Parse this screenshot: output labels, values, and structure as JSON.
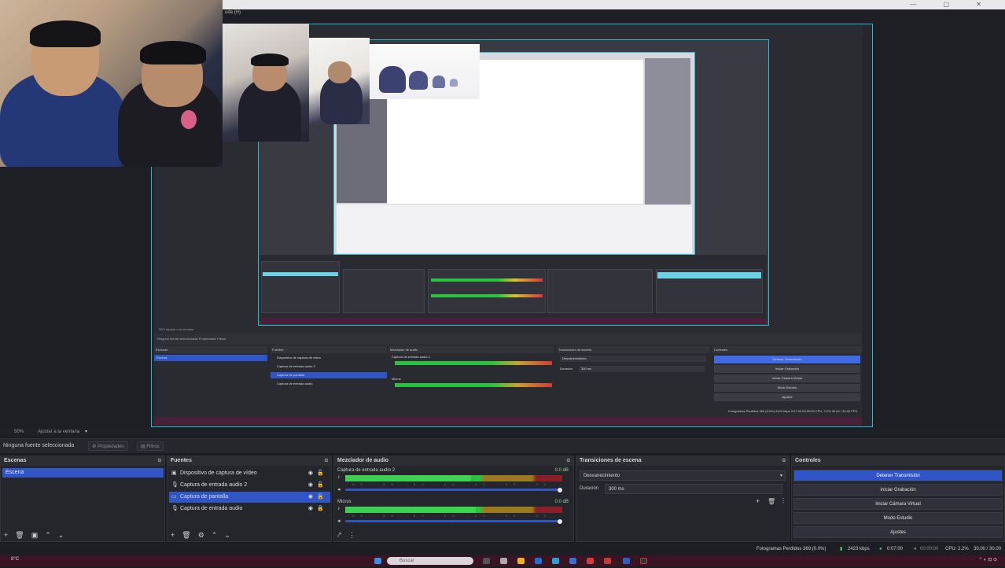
{
  "window": {
    "title": "uda (H)",
    "controls": "— ▢ ✕"
  },
  "toolbar": {
    "zoom": "50%",
    "fit": "Ajustar a la ventana"
  },
  "properties_bar": {
    "no_source": "Ninguna fuente seleccionada",
    "properties_btn": "Propiedades",
    "filters_btn": "Filtros"
  },
  "docks": {
    "scenes": {
      "title": "Escenas",
      "items": [
        "Escena"
      ]
    },
    "sources": {
      "title": "Fuentes",
      "items": [
        {
          "label": "Dispositivo de captura de vídeo",
          "icon": "camera-icon",
          "selected": false
        },
        {
          "label": "Captura de entrada audio 2",
          "icon": "microphone-icon",
          "selected": false
        },
        {
          "label": "Captura de pantalla",
          "icon": "monitor-icon",
          "selected": true
        },
        {
          "label": "Captura de entrada audio",
          "icon": "microphone-icon",
          "selected": false
        }
      ]
    },
    "mixer": {
      "title": "Mezclador de audio",
      "channels": [
        {
          "name": "Captura de entrada audio 2",
          "db": "0.0 dB",
          "level": 0.58,
          "volume": 1.0
        },
        {
          "name": "Micrus",
          "db": "0.0 dB",
          "level": 0.6,
          "volume": 1.0
        }
      ],
      "scale": "-60 -55 -50 -45 -40 -35 -30 -25 -20 -15 -10 -5 0"
    },
    "transitions": {
      "title": "Transiciones de escena",
      "selected": "Desvanecimiento",
      "duration_label": "Duración",
      "duration_value": "300 ms"
    },
    "controls": {
      "title": "Controles",
      "buttons": [
        {
          "label": "Detener Transmisión",
          "primary": true
        },
        {
          "label": "Iniciar Grabación",
          "primary": false
        },
        {
          "label": "Iniciar Cámara Virtual",
          "primary": false
        },
        {
          "label": "Modo Estudio",
          "primary": false
        },
        {
          "label": "Ajustes",
          "primary": false
        }
      ]
    }
  },
  "status": {
    "dropped_frames": "Fotogramas Perdidos 369 (0.0%)",
    "bitrate": "2423 kbps",
    "live_time": "0:07:00",
    "rec_time": "00:00:00",
    "cpu": "CPU: 2.2%",
    "fps": "30.00 / 30.00 FPS"
  },
  "taskbar": {
    "weather": "8°C",
    "search": "Buscar"
  },
  "colors": {
    "accent": "#2f55c6",
    "preview_outline": "#2fb6cf",
    "meter_green": "#2bc241",
    "meter_yellow": "#9b7a1f",
    "meter_red": "#8b1f28"
  },
  "mini": {
    "toolbar": "50%    Ajustar a la ventana",
    "props": "Ninguna fuente seleccionada        Propiedades     Filtros",
    "scenes_h": "Escenas",
    "scene": "Escena",
    "sources_h": "Fuentes",
    "src1": "Dispositivo de captura de vídeo",
    "src2": "Captura de entrada audio 2",
    "src3": "Captura de pantalla",
    "src4": "Captura de entrada audio",
    "mixer_h": "Mezclador de audio",
    "mix1": "Captura de entrada audio 2",
    "mix2": "Micrus",
    "trans_h": "Transiciones de escena",
    "trans_sel": "Desvanecimiento",
    "trans_dur_l": "Duración",
    "trans_dur": "300 ms",
    "ctrl_h": "Controles",
    "c1": "Detener Transmisión",
    "c2": "Iniciar Grabación",
    "c3": "Iniciar Cámara Virtual",
    "c4": "Modo Estudio",
    "c5": "Ajustes",
    "status": "Fotogramas Perdidos 369 (0.0%)   2423 kbps   0:07:00   00:00:00   CPU: 2.2%   30.00 / 30.00 FPS"
  }
}
